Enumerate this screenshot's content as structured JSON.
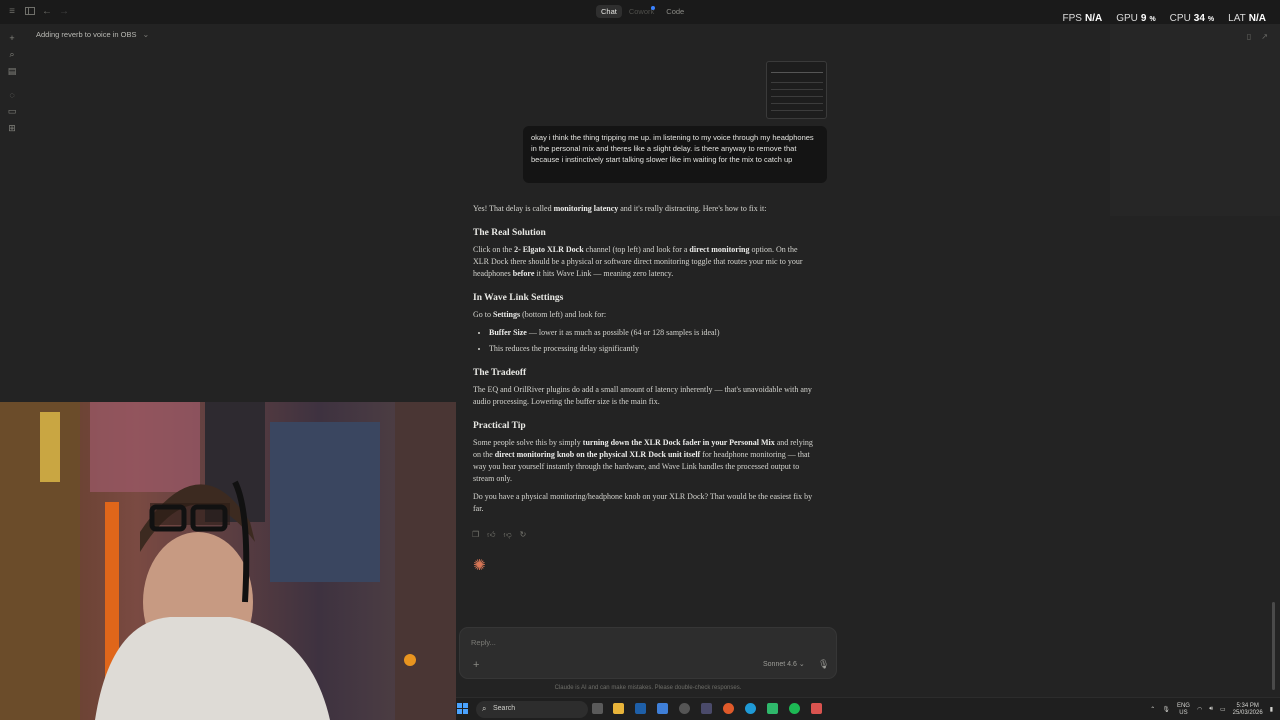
{
  "topbar": {
    "tabs": [
      {
        "label": "Chat",
        "active": true
      },
      {
        "label": "Cowork",
        "active": false
      },
      {
        "label": "Code",
        "active": false
      }
    ]
  },
  "perf": {
    "fps_label": "FPS",
    "fps_value": "N/A",
    "gpu_label": "GPU",
    "gpu_value": "9",
    "gpu_unit": "%",
    "cpu_label": "CPU",
    "cpu_value": "34",
    "cpu_unit": "%",
    "lat_label": "LAT",
    "lat_value": "N/A"
  },
  "conversation": {
    "title": "Adding reverb to voice in OBS"
  },
  "user_message": "okay i think the thing tripping me up. im listening to my voice through my headphones in the personal mix and theres like a slight delay. is there anyway to remove that because i instinctively start talking slower like im waiting for the mix to catch up",
  "assistant": {
    "intro_pre": "Yes! That delay is called ",
    "intro_bold": "monitoring latency",
    "intro_post": " and it's really distracting. Here's how to fix it:",
    "h1": "The Real Solution",
    "p1_a": "Click on the ",
    "p1_b": "2- Elgato XLR Dock",
    "p1_c": " channel (top left) and look for a ",
    "p1_d": "direct monitoring",
    "p1_e": " option. On the XLR Dock there should be a physical or software direct monitoring toggle that routes your mic to your headphones ",
    "p1_f": "before",
    "p1_g": " it hits Wave Link — meaning zero latency.",
    "h2": "In Wave Link Settings",
    "p2_a": "Go to ",
    "p2_b": "Settings",
    "p2_c": " (bottom left) and look for:",
    "li1_b": "Buffer Size",
    "li1_rest": " — lower it as much as possible (64 or 128 samples is ideal)",
    "li2": "This reduces the processing delay significantly",
    "h3": "The Tradeoff",
    "p3": "The EQ and OrilRiver plugins do add a small amount of latency inherently — that's unavoidable with any audio processing. Lowering the buffer size is the main fix.",
    "h4": "Practical Tip",
    "p4_a": "Some people solve this by simply ",
    "p4_b": "turning down the XLR Dock fader in your Personal Mix",
    "p4_c": " and relying on the ",
    "p4_d": "direct monitoring knob on the physical XLR Dock unit itself",
    "p4_e": " for headphone monitoring — that way you hear yourself instantly through the hardware, and Wave Link handles the processed output to stream only.",
    "p5": "Do you have a physical monitoring/headphone knob on your XLR Dock? That would be the easiest fix by far."
  },
  "composer": {
    "placeholder": "Reply...",
    "model": "Sonnet 4.6",
    "disclaimer": "Claude is AI and can make mistakes. Please double-check responses."
  },
  "taskbar": {
    "search_label": "Search",
    "lang_top": "ENG",
    "lang_bottom": "US",
    "time": "5:34 PM",
    "date": "25/03/2026"
  },
  "colors": {
    "accent_claude": "#d97757",
    "background": "#232323",
    "user_bubble": "#141414"
  }
}
